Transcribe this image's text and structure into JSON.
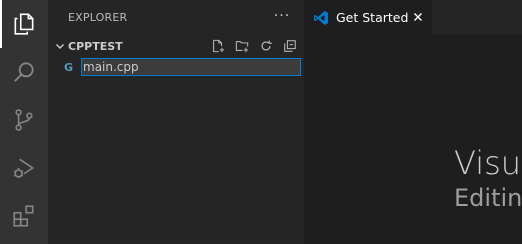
{
  "activity_bar": {
    "items": [
      {
        "icon": "files-icon",
        "active": true
      },
      {
        "icon": "search-icon",
        "active": false
      },
      {
        "icon": "source-control-icon",
        "active": false
      },
      {
        "icon": "run-debug-icon",
        "active": false
      },
      {
        "icon": "extensions-icon",
        "active": false
      }
    ]
  },
  "sidebar": {
    "header": "EXPLORER",
    "more_label": "···",
    "section": {
      "title": "CPPTEST",
      "actions": [
        "new-file-icon",
        "new-folder-icon",
        "refresh-icon",
        "collapse-all-icon"
      ]
    },
    "rename_input": {
      "value": "main.cpp",
      "icon": "cpp-file-icon",
      "icon_glyph": "G"
    }
  },
  "editor": {
    "tabs": [
      {
        "label": "Get Started",
        "icon": "vscode-icon",
        "active": true
      }
    ],
    "welcome": {
      "title": "Visu",
      "subtitle": "Editin"
    }
  },
  "colors": {
    "activity_bar": "#333333",
    "sidebar": "#252526",
    "editor": "#1e1e1e",
    "focus_border": "#007fd4",
    "vscode_blue": "#007acc",
    "cpp_icon": "#519aba"
  }
}
